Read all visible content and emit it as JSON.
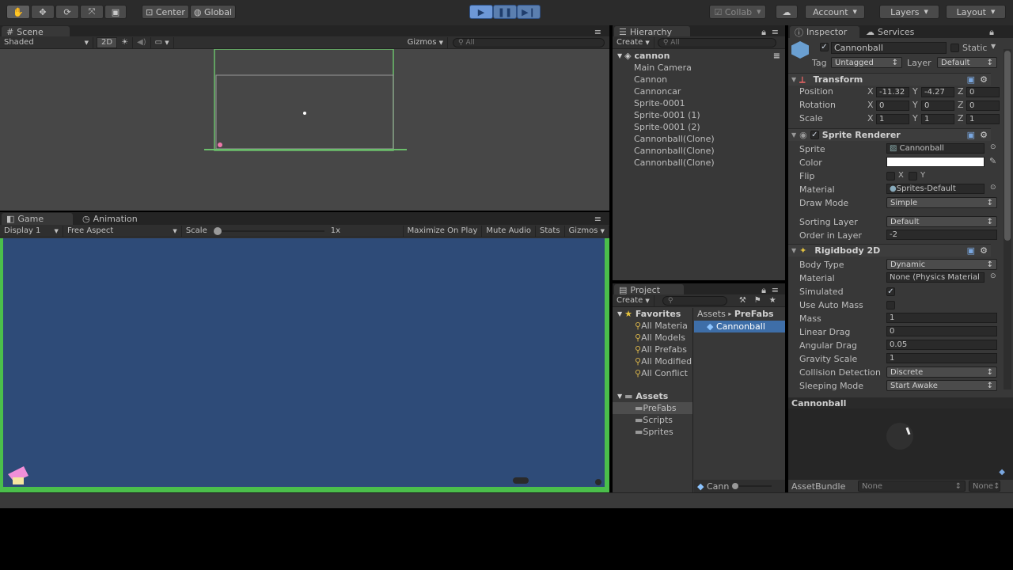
{
  "toolbar": {
    "center": "Center",
    "global": "Global",
    "collab": "Collab",
    "account": "Account",
    "layers": "Layers",
    "layout": "Layout"
  },
  "scene": {
    "tab": "Scene",
    "shading": "Shaded",
    "mode2d": "2D",
    "gizmos": "Gizmos",
    "search": "All"
  },
  "game": {
    "tab": "Game",
    "animation_tab": "Animation",
    "display": "Display 1",
    "aspect": "Free Aspect",
    "scale_label": "Scale",
    "scale_value": "1x",
    "maximize": "Maximize On Play",
    "mute": "Mute Audio",
    "stats": "Stats",
    "gizmos": "Gizmos"
  },
  "hierarchy": {
    "tab": "Hierarchy",
    "create": "Create",
    "search": "All",
    "root": "cannon",
    "items": [
      "Main Camera",
      "Cannon",
      "Cannoncar",
      "Sprite-0001",
      "Sprite-0001 (1)",
      "Sprite-0001 (2)",
      "Cannonball(Clone)",
      "Cannonball(Clone)",
      "Cannonball(Clone)"
    ]
  },
  "project": {
    "tab": "Project",
    "create": "Create",
    "favorites_label": "Favorites",
    "favorites": [
      "All Materia",
      "All Models",
      "All Prefabs",
      "All Modified",
      "All Conflict"
    ],
    "assets_label": "Assets",
    "folders": [
      "PreFabs",
      "Scripts",
      "Sprites"
    ],
    "breadcrumb_root": "Assets",
    "breadcrumb_leaf": "PreFabs",
    "selected_asset": "Cannonball",
    "footer_item": "Cann"
  },
  "inspector": {
    "tab": "Inspector",
    "services_tab": "Services",
    "name": "Cannonball",
    "static_label": "Static",
    "tag_label": "Tag",
    "tag": "Untagged",
    "layer_label": "Layer",
    "layer": "Default",
    "transform": {
      "title": "Transform",
      "position_label": "Position",
      "rotation_label": "Rotation",
      "scale_label": "Scale",
      "pos": [
        "-11.32",
        "-4.27",
        "0"
      ],
      "rot": [
        "0",
        "0",
        "0"
      ],
      "scale": [
        "1",
        "1",
        "1"
      ],
      "x": "X",
      "y": "Y",
      "z": "Z"
    },
    "sprite_renderer": {
      "title": "Sprite Renderer",
      "sprite_label": "Sprite",
      "sprite": "Cannonball",
      "color_label": "Color",
      "flip_label": "Flip",
      "flip_x": "X",
      "flip_y": "Y",
      "material_label": "Material",
      "material": "Sprites-Default",
      "draw_mode_label": "Draw Mode",
      "draw_mode": "Simple",
      "sorting_layer_label": "Sorting Layer",
      "sorting_layer": "Default",
      "order_label": "Order in Layer",
      "order": "-2"
    },
    "rigidbody": {
      "title": "Rigidbody 2D",
      "body_type_label": "Body Type",
      "body_type": "Dynamic",
      "material_label": "Material",
      "material": "None (Physics Material",
      "simulated_label": "Simulated",
      "auto_mass_label": "Use Auto Mass",
      "mass_label": "Mass",
      "mass": "1",
      "linear_drag_label": "Linear Drag",
      "linear_drag": "0",
      "angular_drag_label": "Angular Drag",
      "angular_drag": "0.05",
      "gravity_label": "Gravity Scale",
      "gravity": "1",
      "collision_label": "Collision Detection",
      "collision": "Discrete",
      "sleeping_label": "Sleeping Mode",
      "sleeping": "Start Awake"
    },
    "preview_title": "Cannonball",
    "assetbundle_label": "AssetBundle",
    "assetbundle": "None",
    "assetbundle_variant": "None"
  }
}
